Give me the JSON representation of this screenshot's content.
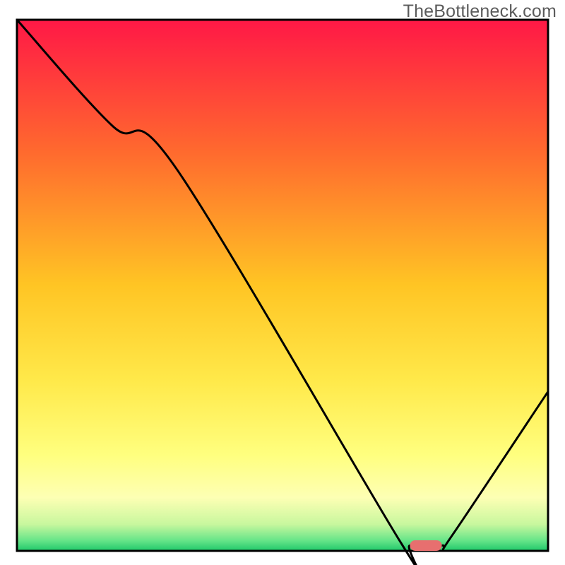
{
  "watermark": "TheBottleneck.com",
  "chart_data": {
    "type": "line",
    "title": "",
    "xlabel": "",
    "ylabel": "",
    "xlim": [
      0,
      100
    ],
    "ylim": [
      0,
      100
    ],
    "x": [
      0,
      18,
      30,
      72,
      74,
      80,
      82,
      100
    ],
    "values": [
      100,
      80,
      72,
      2,
      1,
      1,
      3,
      30
    ],
    "marker": {
      "x_start": 74,
      "x_end": 80,
      "y": 1
    },
    "gradient_stops": [
      {
        "offset": 0,
        "color": "#ff1846"
      },
      {
        "offset": 25,
        "color": "#ff6a2e"
      },
      {
        "offset": 50,
        "color": "#ffc524"
      },
      {
        "offset": 68,
        "color": "#ffe94a"
      },
      {
        "offset": 82,
        "color": "#ffff7f"
      },
      {
        "offset": 90,
        "color": "#fdffb4"
      },
      {
        "offset": 95,
        "color": "#c8f79e"
      },
      {
        "offset": 98,
        "color": "#68e589"
      },
      {
        "offset": 100,
        "color": "#1fc86a"
      }
    ],
    "marker_color": "#e76f6f",
    "line_color": "#000000",
    "border_color": "#000000"
  }
}
